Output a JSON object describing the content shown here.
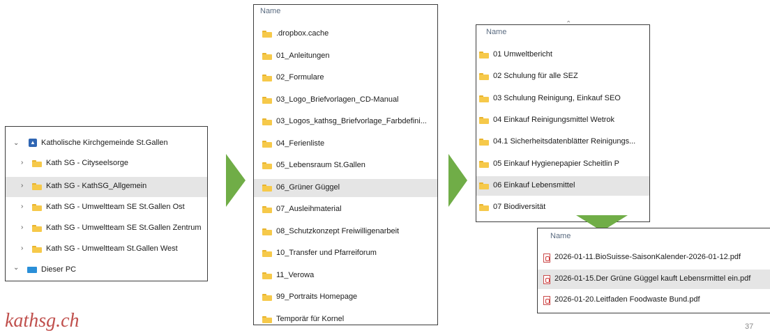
{
  "tree": {
    "root": "Katholische Kirchgemeinde St.Gallen",
    "items": [
      {
        "label": "Kath SG - Cityseelsorge"
      },
      {
        "label": "Kath SG - KathSG_Allgemein"
      },
      {
        "label": "Kath SG - Umweltteam SE St.Gallen Ost"
      },
      {
        "label": "Kath SG - Umweltteam SE St.Gallen Zentrum"
      },
      {
        "label": "Kath SG - Umweltteam St.Gallen West"
      }
    ],
    "pc": "Dieser PC"
  },
  "list1": {
    "header": "Name",
    "items": [
      ".dropbox.cache",
      "01_Anleitungen",
      "02_Formulare",
      "03_Logo_Briefvorlagen_CD-Manual",
      "03_Logos_kathsg_Briefvorlage_Farbdefini...",
      "04_Ferienliste",
      "05_Lebensraum St.Gallen",
      "06_Grüner Güggel",
      "07_Ausleihmaterial",
      "08_Schutzkonzept Freiwilligenarbeit",
      "10_Transfer und Pfarreiforum",
      "11_Verowa",
      "99_Portraits Homepage",
      "Temporär für Kornel"
    ]
  },
  "list2": {
    "header": "Name",
    "items": [
      "01 Umweltbericht",
      "02 Schulung für alle SEZ",
      "03 Schulung Reinigung, Einkauf SEO",
      "04 Einkauf Reinigungsmittel Wetrok",
      "04.1 Sicherheitsdatenblätter Reinigungs...",
      "05 Einkauf Hygienepapier Scheitlin P",
      "06 Einkauf Lebensmittel",
      "07 Biodiversität"
    ]
  },
  "list3": {
    "header": "Name",
    "items": [
      "2026-01-11.BioSuisse-SaisonKalender-2026-01-12.pdf",
      "2026-01-15.Der Grüne Güggel kauft Lebensrmittel ein.pdf",
      "2026-01-20.Leitfaden Foodwaste Bund.pdf"
    ]
  },
  "footer": {
    "logo": "kathsg.ch",
    "page_number": "37"
  },
  "colors": {
    "arrow": "#70ad47",
    "highlight": "#e5e5e5",
    "folder": "#f6c94a",
    "logo": "#c0504d",
    "onedrive_icon": "#2f66b3"
  }
}
